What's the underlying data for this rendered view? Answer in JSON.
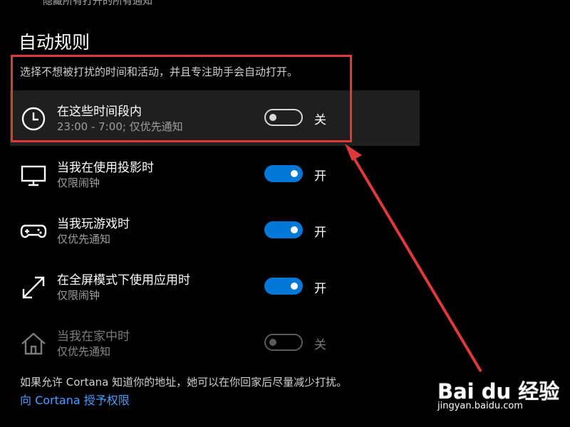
{
  "top_partial_text": "隐藏所有打开的所有通知",
  "section": {
    "title": "自动规则",
    "description": "选择不想被打扰的时间和活动，并且专注助手会自动打开。"
  },
  "rules": [
    {
      "icon": "clock-icon",
      "title": "在这些时间段内",
      "subtitle": "23:00 - 7:00; 仅优先通知",
      "state": "关",
      "enabled": false
    },
    {
      "icon": "monitor-icon",
      "title": "当我在使用投影时",
      "subtitle": "仅限闹钟",
      "state": "开",
      "enabled": true
    },
    {
      "icon": "gamepad-icon",
      "title": "当我玩游戏时",
      "subtitle": "仅优先通知",
      "state": "开",
      "enabled": true
    },
    {
      "icon": "fullscreen-icon",
      "title": "在全屏模式下使用应用时",
      "subtitle": "仅限闹钟",
      "state": "开",
      "enabled": true
    },
    {
      "icon": "home-icon",
      "title": "当我在家中时",
      "subtitle": "仅优先通知",
      "state": "关",
      "enabled": false
    }
  ],
  "footer": {
    "note": "如果允许 Cortana 知道你的地址，她可以在你回家后尽量减少打扰。",
    "link": "向 Cortana 授予权限"
  },
  "watermark": {
    "brand": "Bai du 经验",
    "url": "jingyan.baidu.com"
  },
  "colors": {
    "accent": "#0078d7",
    "highlight_box": "#e0393c",
    "link": "#4a9eff"
  }
}
